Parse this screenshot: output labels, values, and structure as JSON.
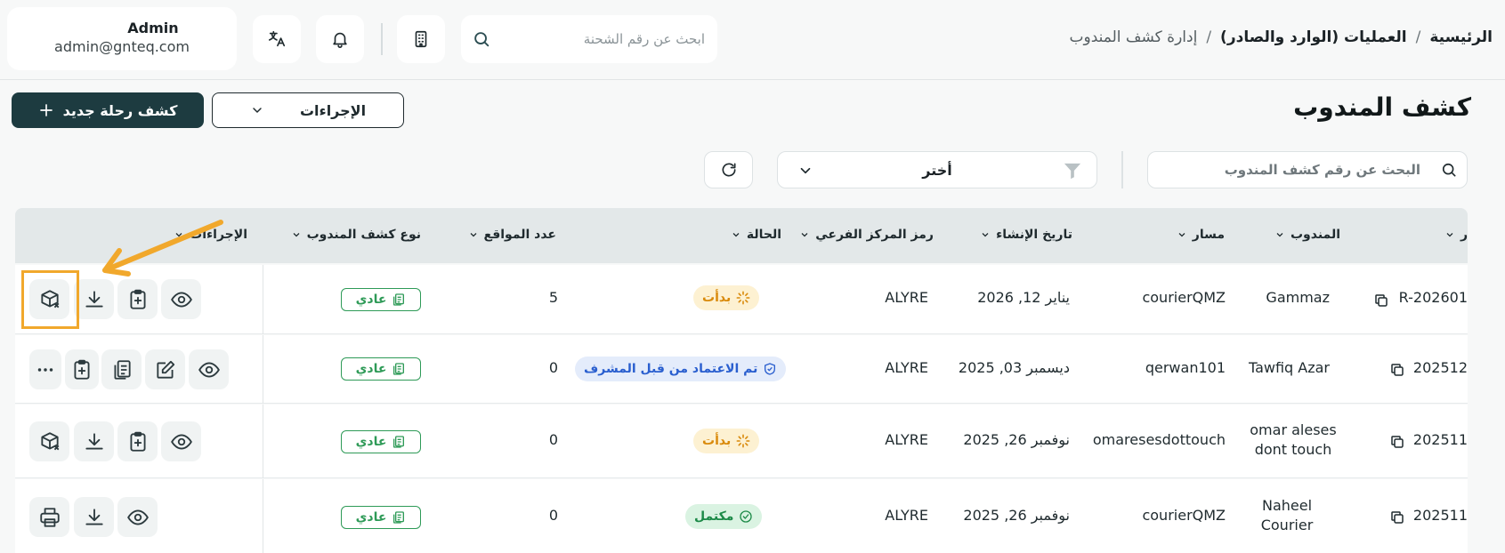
{
  "user": {
    "name": "Admin",
    "email": "admin@gnteq.com"
  },
  "top_search": {
    "placeholder": "ابحث عن رقم الشحنة"
  },
  "breadcrumb": {
    "home": "الرئيسية",
    "section": "العمليات (الوارد والصادر)",
    "current": "إدارة كشف المندوب",
    "separator": "/"
  },
  "page": {
    "title": "كشف المندوب",
    "new_button": "كشف رحلة جديد",
    "actions_button": "الإجراءات"
  },
  "filters": {
    "search_placeholder": "البحث عن رقم كشف المندوب",
    "select_value": "أختر"
  },
  "table": {
    "headers": {
      "id": "ر",
      "courier": "المندوب",
      "route": "مسار",
      "created": "تاريخ الإنشاء",
      "branch": "رمز المركز الفرعي",
      "status": "الحالة",
      "sites": "عدد المواقع",
      "type": "نوع كشف المندوب",
      "actions": "الإجراءات"
    },
    "rows": [
      {
        "id": "R-202601",
        "courier": "Gammaz",
        "route": "courierQMZ",
        "created": "يناير 12, 2026",
        "branch": "ALYRE",
        "status": "بدأت",
        "sites": "5",
        "type": "عادي"
      },
      {
        "id": "202512",
        "courier": "Tawfiq Azar",
        "route": "qerwan101",
        "created": "ديسمبر 03, 2025",
        "branch": "ALYRE",
        "status": "تم الاعتماد من قبل المشرف",
        "sites": "0",
        "type": "عادي"
      },
      {
        "id": "202511",
        "courier": "omar aleses dont touch",
        "route": "omaresesdottouch",
        "created": "نوفمبر 26, 2025",
        "branch": "ALYRE",
        "status": "بدأت",
        "sites": "0",
        "type": "عادي"
      },
      {
        "id": "202511",
        "courier": "Naheel Courier",
        "route": "courierQMZ",
        "created": "نوفمبر 26, 2025",
        "branch": "ALYRE",
        "status": "مكتمل",
        "sites": "0",
        "type": "عادي"
      }
    ]
  },
  "colors": {
    "primary": "#1d3b40",
    "highlight": "#f1a82c",
    "started": "#d98a0b",
    "approved": "#2a5fcf",
    "completed": "#1d8a48",
    "type_badge": "#2e9a57"
  }
}
